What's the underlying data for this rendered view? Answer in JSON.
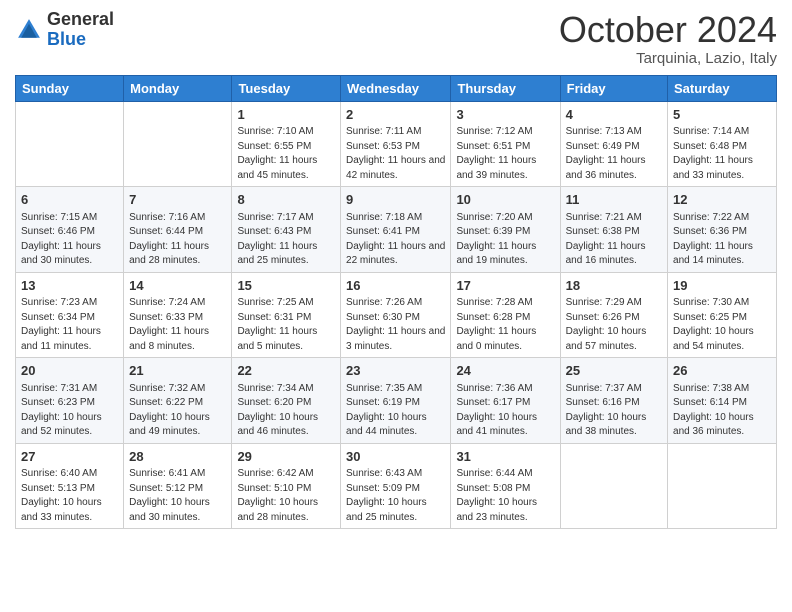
{
  "logo": {
    "general": "General",
    "blue": "Blue"
  },
  "title": "October 2024",
  "location": "Tarquinia, Lazio, Italy",
  "days_header": [
    "Sunday",
    "Monday",
    "Tuesday",
    "Wednesday",
    "Thursday",
    "Friday",
    "Saturday"
  ],
  "weeks": [
    [
      {
        "day": "",
        "info": ""
      },
      {
        "day": "",
        "info": ""
      },
      {
        "day": "1",
        "info": "Sunrise: 7:10 AM\nSunset: 6:55 PM\nDaylight: 11 hours and 45 minutes."
      },
      {
        "day": "2",
        "info": "Sunrise: 7:11 AM\nSunset: 6:53 PM\nDaylight: 11 hours and 42 minutes."
      },
      {
        "day": "3",
        "info": "Sunrise: 7:12 AM\nSunset: 6:51 PM\nDaylight: 11 hours and 39 minutes."
      },
      {
        "day": "4",
        "info": "Sunrise: 7:13 AM\nSunset: 6:49 PM\nDaylight: 11 hours and 36 minutes."
      },
      {
        "day": "5",
        "info": "Sunrise: 7:14 AM\nSunset: 6:48 PM\nDaylight: 11 hours and 33 minutes."
      }
    ],
    [
      {
        "day": "6",
        "info": "Sunrise: 7:15 AM\nSunset: 6:46 PM\nDaylight: 11 hours and 30 minutes."
      },
      {
        "day": "7",
        "info": "Sunrise: 7:16 AM\nSunset: 6:44 PM\nDaylight: 11 hours and 28 minutes."
      },
      {
        "day": "8",
        "info": "Sunrise: 7:17 AM\nSunset: 6:43 PM\nDaylight: 11 hours and 25 minutes."
      },
      {
        "day": "9",
        "info": "Sunrise: 7:18 AM\nSunset: 6:41 PM\nDaylight: 11 hours and 22 minutes."
      },
      {
        "day": "10",
        "info": "Sunrise: 7:20 AM\nSunset: 6:39 PM\nDaylight: 11 hours and 19 minutes."
      },
      {
        "day": "11",
        "info": "Sunrise: 7:21 AM\nSunset: 6:38 PM\nDaylight: 11 hours and 16 minutes."
      },
      {
        "day": "12",
        "info": "Sunrise: 7:22 AM\nSunset: 6:36 PM\nDaylight: 11 hours and 14 minutes."
      }
    ],
    [
      {
        "day": "13",
        "info": "Sunrise: 7:23 AM\nSunset: 6:34 PM\nDaylight: 11 hours and 11 minutes."
      },
      {
        "day": "14",
        "info": "Sunrise: 7:24 AM\nSunset: 6:33 PM\nDaylight: 11 hours and 8 minutes."
      },
      {
        "day": "15",
        "info": "Sunrise: 7:25 AM\nSunset: 6:31 PM\nDaylight: 11 hours and 5 minutes."
      },
      {
        "day": "16",
        "info": "Sunrise: 7:26 AM\nSunset: 6:30 PM\nDaylight: 11 hours and 3 minutes."
      },
      {
        "day": "17",
        "info": "Sunrise: 7:28 AM\nSunset: 6:28 PM\nDaylight: 11 hours and 0 minutes."
      },
      {
        "day": "18",
        "info": "Sunrise: 7:29 AM\nSunset: 6:26 PM\nDaylight: 10 hours and 57 minutes."
      },
      {
        "day": "19",
        "info": "Sunrise: 7:30 AM\nSunset: 6:25 PM\nDaylight: 10 hours and 54 minutes."
      }
    ],
    [
      {
        "day": "20",
        "info": "Sunrise: 7:31 AM\nSunset: 6:23 PM\nDaylight: 10 hours and 52 minutes."
      },
      {
        "day": "21",
        "info": "Sunrise: 7:32 AM\nSunset: 6:22 PM\nDaylight: 10 hours and 49 minutes."
      },
      {
        "day": "22",
        "info": "Sunrise: 7:34 AM\nSunset: 6:20 PM\nDaylight: 10 hours and 46 minutes."
      },
      {
        "day": "23",
        "info": "Sunrise: 7:35 AM\nSunset: 6:19 PM\nDaylight: 10 hours and 44 minutes."
      },
      {
        "day": "24",
        "info": "Sunrise: 7:36 AM\nSunset: 6:17 PM\nDaylight: 10 hours and 41 minutes."
      },
      {
        "day": "25",
        "info": "Sunrise: 7:37 AM\nSunset: 6:16 PM\nDaylight: 10 hours and 38 minutes."
      },
      {
        "day": "26",
        "info": "Sunrise: 7:38 AM\nSunset: 6:14 PM\nDaylight: 10 hours and 36 minutes."
      }
    ],
    [
      {
        "day": "27",
        "info": "Sunrise: 6:40 AM\nSunset: 5:13 PM\nDaylight: 10 hours and 33 minutes."
      },
      {
        "day": "28",
        "info": "Sunrise: 6:41 AM\nSunset: 5:12 PM\nDaylight: 10 hours and 30 minutes."
      },
      {
        "day": "29",
        "info": "Sunrise: 6:42 AM\nSunset: 5:10 PM\nDaylight: 10 hours and 28 minutes."
      },
      {
        "day": "30",
        "info": "Sunrise: 6:43 AM\nSunset: 5:09 PM\nDaylight: 10 hours and 25 minutes."
      },
      {
        "day": "31",
        "info": "Sunrise: 6:44 AM\nSunset: 5:08 PM\nDaylight: 10 hours and 23 minutes."
      },
      {
        "day": "",
        "info": ""
      },
      {
        "day": "",
        "info": ""
      }
    ]
  ]
}
